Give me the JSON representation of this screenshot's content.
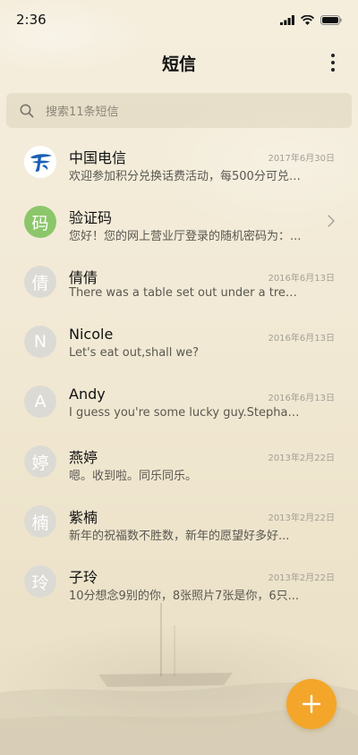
{
  "status_bar": {
    "time": "2:36"
  },
  "header": {
    "title": "短信"
  },
  "search": {
    "placeholder": "搜索11条短信"
  },
  "colors": {
    "accent": "#f3a62a",
    "avatar_green": "#8cc66a",
    "avatar_gray": "#dcdad4"
  },
  "conversations": [
    {
      "name": "中国电信",
      "date": "2017年6月30日",
      "preview": "欢迎参加积分兑换话费活动，每500分可兑换...",
      "avatar_icon": "china-telecom-logo"
    },
    {
      "name": "验证码",
      "date": "",
      "preview": "您好！您的网上营业厅登录的随机密码为：...",
      "avatar_text": "码",
      "has_chevron": true
    },
    {
      "name": "倩倩",
      "date": "2016年6月13日",
      "preview": "There was a table set out under a tree in...",
      "avatar_text": "倩"
    },
    {
      "name": "Nicole",
      "date": "2016年6月13日",
      "preview": "Let's eat out,shall we?",
      "avatar_text": "N"
    },
    {
      "name": "Andy",
      "date": "2016年6月13日",
      "preview": "I guess you're some lucky guy.Stephani...",
      "avatar_text": "A"
    },
    {
      "name": "燕婷",
      "date": "2013年2月22日",
      "preview": "嗯。收到啦。同乐同乐。",
      "avatar_text": "婷"
    },
    {
      "name": "紫楠",
      "date": "2013年2月22日",
      "preview": "新年的祝福数不胜数，新年的愿望好多好...",
      "avatar_text": "楠"
    },
    {
      "name": "子玲",
      "date": "2013年2月22日",
      "preview": "10分想念9别的你，8张照片7张是你，6只...",
      "avatar_text": "玲"
    }
  ],
  "fab": {
    "icon": "plus-icon"
  }
}
